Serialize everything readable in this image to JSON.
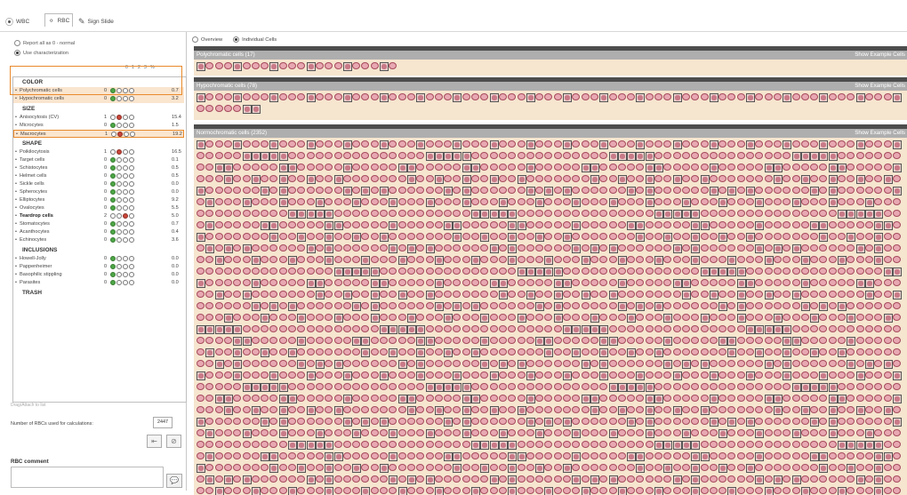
{
  "tabs": [
    {
      "label": "WBC",
      "icon": "wbc-icon",
      "active": false
    },
    {
      "label": "RBC",
      "icon": "rbc-icon",
      "active": true
    },
    {
      "label": "Sign Slide",
      "icon": "sign-icon",
      "active": false
    }
  ],
  "options": {
    "report_all": "Report all as 0 - normal",
    "use_char": "Use characterization"
  },
  "grades_header": [
    "0",
    "1",
    "2",
    "3",
    "%"
  ],
  "sections": [
    {
      "title": "COLOR",
      "rows": [
        {
          "label": "Polychromatic cells",
          "count": "0",
          "grade": 0,
          "pct": "0.7",
          "hl": true
        },
        {
          "label": "Hypochromatic cells",
          "count": "0",
          "grade": 0,
          "pct": "3.2",
          "hl": true
        }
      ]
    },
    {
      "title": "SIZE",
      "rows": [
        {
          "label": "Anisocytosis (CV)",
          "count": "1",
          "grade": 1,
          "pct": "15.4"
        },
        {
          "label": "Microcytes",
          "count": "0",
          "grade": 0,
          "pct": "1.5"
        },
        {
          "label": "Macrocytes",
          "count": "1",
          "grade": 1,
          "pct": "19.2",
          "hlbox": true
        }
      ]
    },
    {
      "title": "SHAPE",
      "rows": [
        {
          "label": "Poikilocytosis",
          "count": "1",
          "grade": 1,
          "pct": "16.5"
        },
        {
          "label": "Target cells",
          "count": "0",
          "grade": 0,
          "pct": "0.1"
        },
        {
          "label": "Schistocytes",
          "count": "0",
          "grade": 0,
          "pct": "0.5"
        },
        {
          "label": "Helmet cells",
          "count": "0",
          "grade": 0,
          "pct": "0.5"
        },
        {
          "label": "Sickle cells",
          "count": "0",
          "grade": 0,
          "pct": "0.0"
        },
        {
          "label": "Spherocytes",
          "count": "0",
          "grade": 0,
          "pct": "0.0"
        },
        {
          "label": "Elliptocytes",
          "count": "0",
          "grade": 0,
          "pct": "9.2"
        },
        {
          "label": "Ovalocytes",
          "count": "0",
          "grade": 0,
          "pct": "5.5"
        },
        {
          "label": "Teardrop cells",
          "count": "2",
          "grade": 2,
          "pct": "5.0",
          "bold": true
        },
        {
          "label": "Stomatocytes",
          "count": "0",
          "grade": 0,
          "pct": "0.7"
        },
        {
          "label": "Acanthocytes",
          "count": "0",
          "grade": 0,
          "pct": "0.4"
        },
        {
          "label": "Echinocytes",
          "count": "0",
          "grade": 0,
          "pct": "3.6"
        }
      ]
    },
    {
      "title": "INCLUSIONS",
      "rows": [
        {
          "label": "Howell-Jolly",
          "count": "0",
          "grade": 0,
          "pct": "0.0"
        },
        {
          "label": "Pappenheimer",
          "count": "0",
          "grade": 0,
          "pct": "0.0"
        },
        {
          "label": "Basophilic stippling",
          "count": "0",
          "grade": 0,
          "pct": "0.0"
        },
        {
          "label": "Parasites",
          "count": "0",
          "grade": 0,
          "pct": "0.0"
        }
      ]
    },
    {
      "title": "TRASH",
      "rows": []
    }
  ],
  "footer": {
    "faded_note": "Drag/Attach to list",
    "nrbc_label": "Number of RBCs used for calculations:",
    "nrbc_value": "2447",
    "rbc_comment_title": "RBC comment"
  },
  "view": {
    "overview": "Overview",
    "individual": "Individual Cells",
    "selected": "individual"
  },
  "panels": [
    {
      "title": "Polychromatic cells (17)",
      "show": "Show Example Cells"
    },
    {
      "title": "Hypochromatic cells (78)",
      "show": "Show Example Cells"
    },
    {
      "title": "Normochromatic cells (2352)",
      "show": "Show Example Cells"
    }
  ],
  "colors": {
    "highlight": "#fae5cf",
    "orange": "#e98a2c",
    "green": "#4da646",
    "red": "#c8463a",
    "cell_bg": "#f6e5cf"
  }
}
